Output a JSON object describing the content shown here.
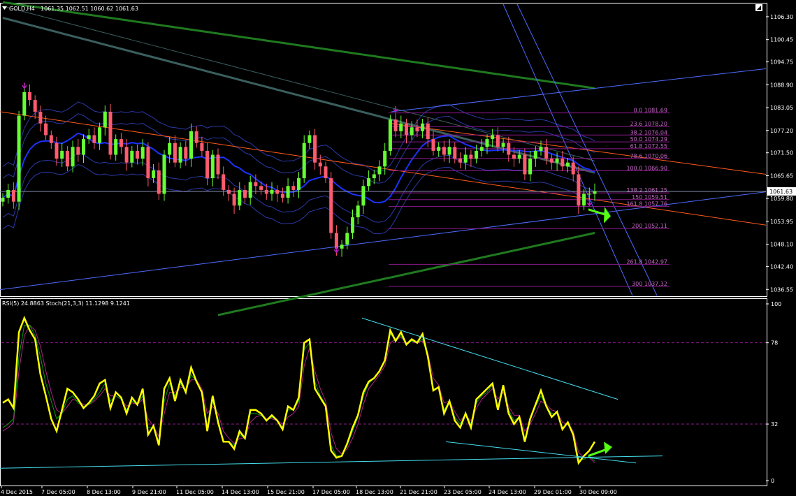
{
  "window": {
    "symbol_label": "GOLD,H4",
    "ohlc": "1061.35 1062.51 1060.62 1061.63",
    "current_price": "1061.63"
  },
  "colors": {
    "background": "#000000",
    "axis": "#ffffff",
    "bull_candle": "#66ff33",
    "bear_candle": "#ff5b6e",
    "rsi_line": "#ffff00",
    "stoch_main": "#00a000",
    "stoch_signal": "#b0208a",
    "fib_lines": "#8b1a8b",
    "fib_text": "#c266c2",
    "ma_blue": "#1a33ff",
    "envelope": "#2b3aa8",
    "slow_ma_gray": "#3b5f5f",
    "slow_ma_green": "#1f7a1f",
    "trend_orange": "#ff5a1a",
    "trend_blue": "#4d6bff",
    "trend_cyan": "#44ddee",
    "arrow_green": "#55ff11",
    "marker_purple": "#c020c0"
  },
  "chart_data": [
    {
      "type": "candlestick",
      "title": "GOLD,H4",
      "ylim": [
        1035.0,
        1109.5
      ],
      "y_ticks": [
        "1106.30",
        "1100.45",
        "1094.75",
        "1088.90",
        "1083.05",
        "1077.20",
        "1071.50",
        "1065.65",
        "1059.80",
        "1053.95",
        "1048.10",
        "1042.40",
        "1036.55"
      ],
      "x_ticks": [
        "4 Dec 2015",
        "7 Dec 05:00",
        "8 Dec 13:00",
        "9 Dec 21:00",
        "11 Dec 05:00",
        "14 Dec 13:00",
        "15 Dec 21:00",
        "17 Dec 05:00",
        "18 Dec 13:00",
        "21 Dec 21:00",
        "23 Dec 05:00",
        "24 Dec 13:00",
        "29 Dec 01:00",
        "30 Dec 09:00"
      ],
      "closes": [
        1060,
        1062,
        1059,
        1081,
        1087,
        1085,
        1082,
        1079,
        1076,
        1074,
        1070,
        1072,
        1068,
        1073,
        1071,
        1075,
        1076,
        1074,
        1078,
        1082,
        1071,
        1075,
        1073,
        1069,
        1072,
        1070,
        1073,
        1065,
        1067,
        1061,
        1071,
        1074,
        1069,
        1073,
        1070,
        1077,
        1074,
        1072,
        1065,
        1071,
        1066,
        1062,
        1061,
        1058,
        1062,
        1060,
        1064,
        1063,
        1062,
        1061,
        1062,
        1061,
        1060,
        1063,
        1062,
        1065,
        1074,
        1076,
        1069,
        1068,
        1065,
        1051,
        1047,
        1048,
        1051,
        1055,
        1058,
        1063,
        1065,
        1066,
        1068,
        1072,
        1080,
        1077,
        1079,
        1076,
        1078,
        1077,
        1079,
        1075,
        1072,
        1073,
        1071,
        1073,
        1070,
        1069,
        1071,
        1070,
        1072,
        1073,
        1075,
        1076,
        1073,
        1074,
        1071,
        1070,
        1071,
        1066,
        1070,
        1072,
        1073,
        1070,
        1069,
        1070,
        1068,
        1069,
        1066,
        1058,
        1061,
        1061,
        1061.63
      ],
      "current_price": 1061.63,
      "fibonacci_levels": [
        {
          "label": "0.0 1081.69",
          "value": 1081.69
        },
        {
          "label": "23.6 1078.20",
          "value": 1078.2
        },
        {
          "label": "38.2 1076.04",
          "value": 1076.04
        },
        {
          "label": "50.0 1074.29",
          "value": 1074.29
        },
        {
          "label": "61.8 1072.55",
          "value": 1072.55
        },
        {
          "label": "78.6 1070.06",
          "value": 1070.06
        },
        {
          "label": "100.0 1066.90",
          "value": 1066.9
        },
        {
          "label": "138.2 1061.25",
          "value": 1061.25
        },
        {
          "label": "150 1059.51",
          "value": 1059.51
        },
        {
          "label": "161.8 1057.76",
          "value": 1057.76
        },
        {
          "label": "200 1052.11",
          "value": 1052.11
        },
        {
          "label": "261.8 1042.97",
          "value": 1042.97
        },
        {
          "label": "300 1037.32",
          "value": 1037.32
        }
      ]
    },
    {
      "type": "line",
      "title": "RSI(5) 24.8863 Stoch(21,3,3) 11.1298 9.1241",
      "ylim": [
        0,
        100
      ],
      "y_ticks": [
        "100",
        "78",
        "32",
        "0"
      ],
      "levels": [
        78,
        32
      ],
      "series": [
        {
          "name": "RSI(5)",
          "values": [
            44,
            46,
            41,
            84,
            92,
            85,
            80,
            60,
            48,
            35,
            28,
            40,
            52,
            50,
            46,
            41,
            44,
            48,
            55,
            57,
            41,
            50,
            47,
            38,
            47,
            43,
            52,
            26,
            31,
            20,
            52,
            58,
            45,
            57,
            50,
            64,
            56,
            50,
            28,
            48,
            33,
            22,
            22,
            18,
            28,
            24,
            40,
            40,
            38,
            34,
            37,
            34,
            29,
            42,
            40,
            47,
            78,
            80,
            52,
            47,
            42,
            17,
            13,
            14,
            21,
            30,
            37,
            50,
            56,
            58,
            62,
            68,
            85,
            79,
            84,
            77,
            80,
            78,
            83,
            70,
            51,
            53,
            38,
            45,
            34,
            30,
            38,
            30,
            46,
            49,
            52,
            55,
            40,
            54,
            38,
            32,
            36,
            22,
            35,
            43,
            51,
            42,
            36,
            39,
            29,
            33,
            26,
            10,
            14,
            17,
            22
          ]
        },
        {
          "name": "Stoch main",
          "values": [
            30,
            32,
            35,
            70,
            88,
            88,
            82,
            70,
            55,
            45,
            35,
            38,
            46,
            48,
            44,
            42,
            43,
            46,
            50,
            55,
            45,
            48,
            46,
            40,
            45,
            43,
            48,
            30,
            30,
            22,
            45,
            55,
            48,
            55,
            50,
            60,
            56,
            50,
            30,
            45,
            35,
            22,
            22,
            20,
            26,
            24,
            38,
            38,
            37,
            34,
            36,
            34,
            30,
            40,
            40,
            45,
            74,
            78,
            56,
            48,
            43,
            20,
            14,
            14,
            20,
            28,
            36,
            48,
            55,
            58,
            62,
            68,
            83,
            80,
            82,
            77,
            79,
            78,
            80,
            70,
            52,
            52,
            40,
            45,
            36,
            32,
            38,
            32,
            44,
            48,
            50,
            54,
            42,
            52,
            40,
            34,
            36,
            24,
            34,
            42,
            48,
            42,
            38,
            38,
            30,
            32,
            26,
            12,
            12,
            14,
            11
          ]
        },
        {
          "name": "Stoch signal",
          "values": [
            28,
            30,
            33,
            62,
            82,
            88,
            85,
            76,
            62,
            50,
            40,
            38,
            42,
            46,
            45,
            43,
            43,
            45,
            48,
            52,
            48,
            48,
            46,
            42,
            44,
            43,
            46,
            35,
            31,
            25,
            38,
            50,
            50,
            53,
            52,
            57,
            57,
            52,
            38,
            42,
            38,
            28,
            24,
            21,
            24,
            24,
            33,
            36,
            37,
            35,
            35,
            34,
            32,
            36,
            38,
            42,
            65,
            75,
            62,
            52,
            45,
            27,
            18,
            15,
            18,
            24,
            32,
            43,
            52,
            56,
            60,
            65,
            78,
            80,
            81,
            78,
            79,
            78,
            79,
            72,
            58,
            54,
            44,
            45,
            39,
            34,
            37,
            34,
            41,
            46,
            49,
            52,
            46,
            50,
            42,
            37,
            37,
            28,
            32,
            38,
            45,
            43,
            40,
            39,
            33,
            32,
            28,
            16,
            13,
            13,
            10
          ]
        }
      ],
      "x_ticks": [
        "4 Dec 2015",
        "7 Dec 05:00",
        "8 Dec 13:00",
        "9 Dec 21:00",
        "11 Dec 05:00",
        "14 Dec 13:00",
        "15 Dec 21:00",
        "17 Dec 05:00",
        "18 Dec 13:00",
        "21 Dec 21:00",
        "23 Dec 05:00",
        "24 Dec 13:00",
        "29 Dec 01:00",
        "30 Dec 09:00"
      ]
    }
  ]
}
